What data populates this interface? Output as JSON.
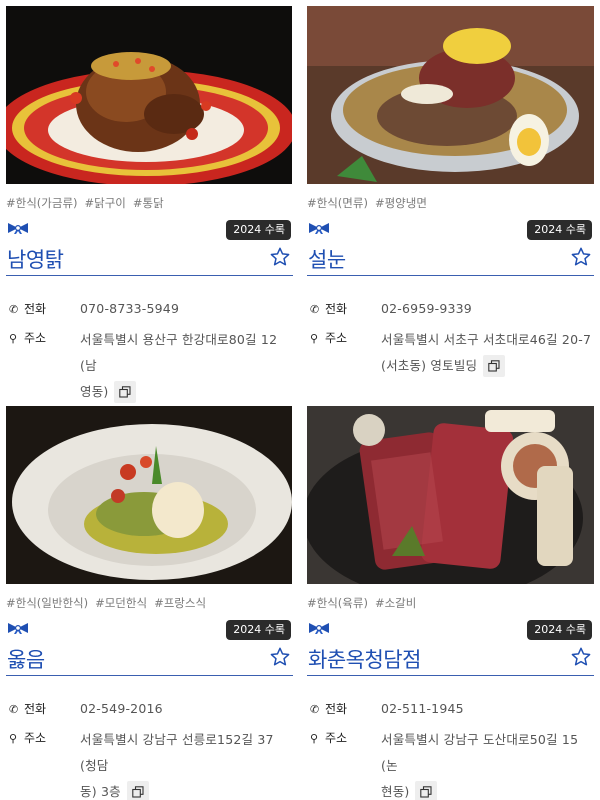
{
  "award_badge": "2024 수록",
  "labels": {
    "phone": "전화",
    "address": "주소"
  },
  "colors": {
    "title": "#1f4fb2",
    "divider": "#3a5fb0",
    "badge_bg": "#2b2b2b",
    "ribbon": "#1f4fb2"
  },
  "icons": {
    "ribbon": "ribbon-icon",
    "star": "star-outline-icon",
    "phone": "phone-icon",
    "location": "map-pin-icon",
    "copy": "copy-icon"
  },
  "restaurants": [
    {
      "name": "남영탉",
      "tags": [
        "#한식(가금류)",
        "#닭구이",
        "#통닭"
      ],
      "phone": "070-8733-5949",
      "address_line1": "서울특별시 용산구 한강대로80길 12 (남",
      "address_line2": "영동)",
      "photo": "roast-chicken-photo"
    },
    {
      "name": "설눈",
      "tags": [
        "#한식(면류)",
        "#평양냉면"
      ],
      "phone": "02-6959-9339",
      "address_line1": "서울특별시 서초구 서초대로46길 20-7",
      "address_line2": "(서초동) 영토빌딩",
      "photo": "cold-noodles-photo"
    },
    {
      "name": "옳음",
      "tags": [
        "#한식(일반한식)",
        "#모던한식",
        "#프랑스식"
      ],
      "phone": "02-549-2016",
      "address_line1": "서울특별시 강남구 선릉로152길 37 (청담",
      "address_line2": "동) 3층",
      "photo": "modern-dish-photo"
    },
    {
      "name": "화춘옥청담점",
      "tags": [
        "#한식(육류)",
        "#소갈비"
      ],
      "phone": "02-511-1945",
      "address_line1": "서울특별시 강남구 도산대로50길 15 (논",
      "address_line2": "현동)",
      "photo": "beef-ribs-photo"
    }
  ]
}
